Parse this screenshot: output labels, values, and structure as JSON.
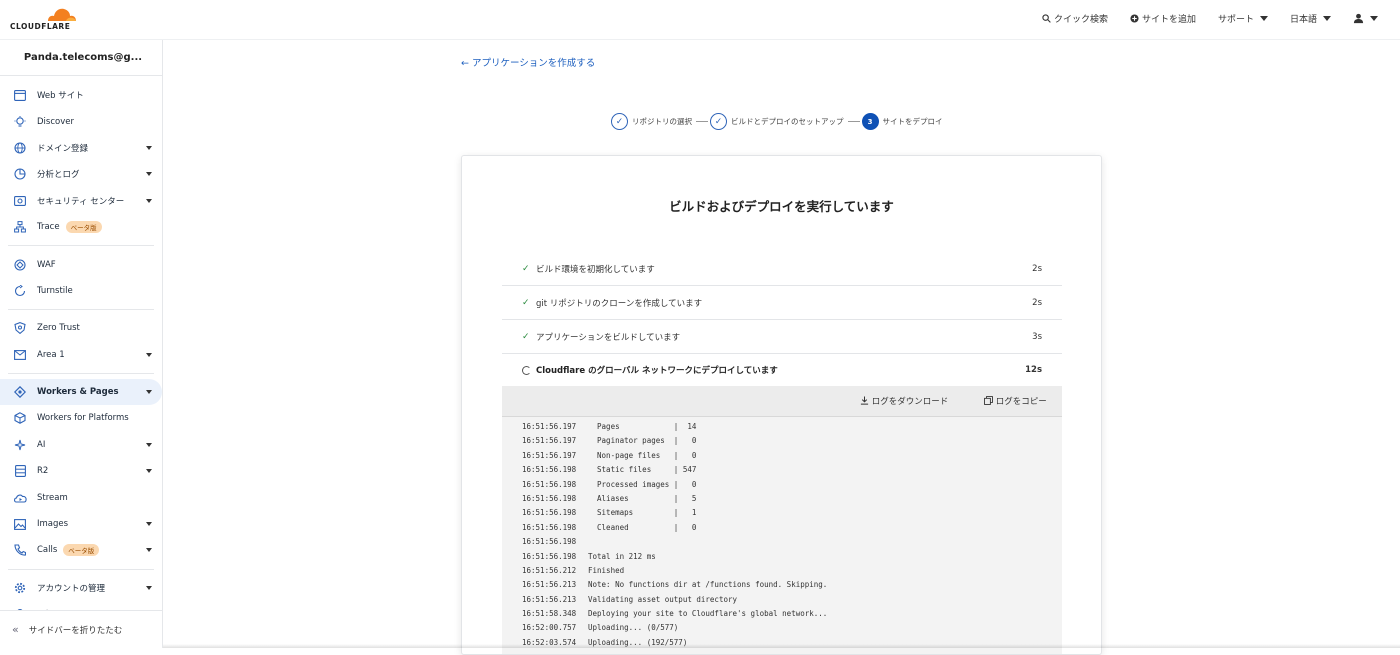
{
  "brand": {
    "logo_text": "CLOUDFLARE",
    "accent": "#f38020"
  },
  "topnav": {
    "search": "クイック検索",
    "add_site": "サイトを追加",
    "support": "サポート",
    "language": "日本語"
  },
  "sidebar": {
    "account": "Panda.telecoms@g...",
    "items": [
      {
        "label": "Web サイト",
        "icon": "browser-icon"
      },
      {
        "label": "Discover",
        "icon": "lightbulb-icon"
      },
      {
        "label": "ドメイン登録",
        "icon": "globe-icon"
      },
      {
        "label": "分析とログ",
        "icon": "pie-chart-icon"
      },
      {
        "label": "セキュリティ センター",
        "icon": "radar-icon"
      },
      {
        "label": "Trace",
        "icon": "network-icon",
        "badge": "ベータ版"
      },
      {
        "label": "WAF",
        "icon": "waf-icon"
      },
      {
        "label": "Turnstile",
        "icon": "turnstile-icon"
      },
      {
        "label": "Zero Trust",
        "icon": "zero-trust-icon"
      },
      {
        "label": "Area 1",
        "icon": "mail-icon"
      },
      {
        "label": "Workers & Pages",
        "icon": "workers-icon"
      },
      {
        "label": "Workers for Platforms",
        "icon": "platforms-icon"
      },
      {
        "label": "AI",
        "icon": "ai-icon"
      },
      {
        "label": "R2",
        "icon": "database-icon"
      },
      {
        "label": "Stream",
        "icon": "stream-icon"
      },
      {
        "label": "Images",
        "icon": "image-icon"
      },
      {
        "label": "Calls",
        "icon": "phone-icon",
        "badge": "ベータ版"
      },
      {
        "label": "アカウントの管理",
        "icon": "gear-icon"
      },
      {
        "label": "通知",
        "icon": "bell-icon"
      }
    ],
    "collapse": "サイドバーを折りたたむ"
  },
  "main": {
    "back_link": "← アプリケーションを作成する",
    "steps": [
      {
        "label": "リポジトリの選択",
        "state": "done"
      },
      {
        "label": "ビルドとデプロイのセットアップ",
        "state": "done"
      },
      {
        "label": "サイトをデプロイ",
        "state": "current",
        "number": "3"
      }
    ],
    "card_title": "ビルドおよびデプロイを実行しています",
    "tasks": [
      {
        "label": "ビルド環境を初期化しています",
        "duration": "2s",
        "state": "done"
      },
      {
        "label": "git リポジトリのクローンを作成しています",
        "duration": "2s",
        "state": "done"
      },
      {
        "label": "アプリケーションをビルドしています",
        "duration": "3s",
        "state": "done"
      },
      {
        "label": "Cloudflare のグローバル ネットワークにデプロイしています",
        "duration": "12s",
        "state": "running"
      }
    ],
    "download_logs": "ログをダウンロード",
    "copy_logs": "ログをコピー",
    "logs": [
      {
        "ts": "16:51:56.197",
        "msg": "  Pages            |  14"
      },
      {
        "ts": "16:51:56.197",
        "msg": "  Paginator pages  |   0"
      },
      {
        "ts": "16:51:56.197",
        "msg": "  Non-page files   |   0"
      },
      {
        "ts": "16:51:56.198",
        "msg": "  Static files     | 547"
      },
      {
        "ts": "16:51:56.198",
        "msg": "  Processed images |   0"
      },
      {
        "ts": "16:51:56.198",
        "msg": "  Aliases          |   5"
      },
      {
        "ts": "16:51:56.198",
        "msg": "  Sitemaps         |   1"
      },
      {
        "ts": "16:51:56.198",
        "msg": "  Cleaned          |   0"
      },
      {
        "ts": "16:51:56.198",
        "msg": ""
      },
      {
        "ts": "16:51:56.198",
        "msg": "Total in 212 ms"
      },
      {
        "ts": "16:51:56.212",
        "msg": "Finished"
      },
      {
        "ts": "16:51:56.213",
        "msg": "Note: No functions dir at /functions found. Skipping."
      },
      {
        "ts": "16:51:56.213",
        "msg": "Validating asset output directory"
      },
      {
        "ts": "16:51:58.348",
        "msg": "Deploying your site to Cloudflare's global network..."
      },
      {
        "ts": "16:52:00.757",
        "msg": "Uploading... (0/577)"
      },
      {
        "ts": "16:52:03.574",
        "msg": "Uploading... (192/577)"
      }
    ]
  }
}
